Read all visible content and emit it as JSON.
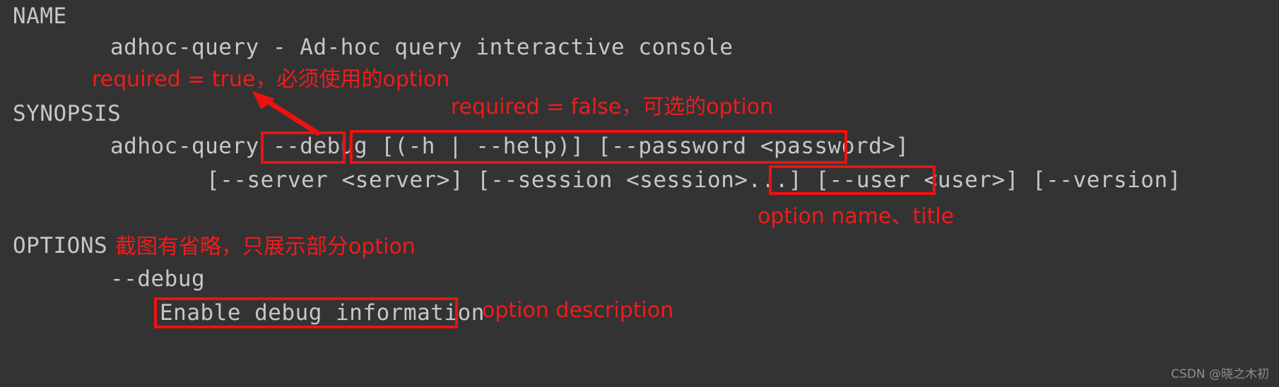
{
  "terminal": {
    "sections": {
      "name_heading": "NAME",
      "name_body": "adhoc-query - Ad-hoc query interactive console",
      "synopsis_heading": "SYNOPSIS",
      "synopsis_line1": "adhoc-query --debug [(-h | --help)] [--password <password>]",
      "synopsis_line2": "[--server <server>] [--session <session>...] [--user <user>] [--version]",
      "options_heading": "OPTIONS",
      "option_name": "--debug",
      "option_description": "Enable debug information"
    }
  },
  "annotations": {
    "required_true": "required = true，必须使用的option",
    "required_false": "required = false，可选的option",
    "option_name_title": "option name、title",
    "options_note": "截图有省略，只展示部分option",
    "option_description_label": "option description"
  },
  "highlight_boxes": [
    {
      "name": "debug-flag",
      "label": "--debug"
    },
    {
      "name": "optional-args",
      "label": "[(-h | --help)] [--password <password>]"
    },
    {
      "name": "user-option",
      "label": "--user <user>"
    },
    {
      "name": "option-description",
      "label": "Enable debug information"
    }
  ],
  "watermark": "CSDN @晓之木初",
  "colors": {
    "background": "#333333",
    "terminal_text": "#c7c7c7",
    "annotation_red": "#ee1111",
    "watermark_gray": "#8e8e8e"
  }
}
